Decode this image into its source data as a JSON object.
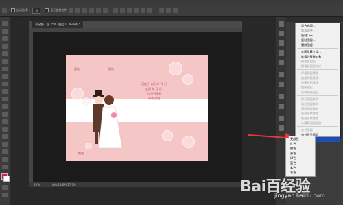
{
  "options_bar": {
    "auto_select_label": "自动选择:",
    "layer_dropdown": "组",
    "show_transform_label": "显示变换控件"
  },
  "document": {
    "tab_title": "未标题-1 @ 75% (图层 1, RGB/8) *",
    "zoom": "25%",
    "doc_info": "文档:13.6M/17.7M"
  },
  "artwork": {
    "title_left": "喜帖",
    "title_right": "喜帖",
    "text_lines": [
      "谨定于 公历 年 月 日",
      "农历 年 月 日",
      "为 举行婚礼",
      "恭请 光临"
    ],
    "footer_text": "敬邀"
  },
  "context_menu": {
    "items": [
      {
        "label": "混合选项...",
        "state": "normal"
      },
      {
        "label": "编辑调整...",
        "state": "disabled"
      },
      {
        "label": "复制CSS",
        "state": "normal"
      },
      {
        "label": "复制图层...",
        "state": "normal"
      },
      {
        "label": "删除图层",
        "state": "normal"
      },
      {
        "label": "从图层建立组...",
        "state": "normal"
      },
      {
        "label": "转换为智能对象",
        "state": "normal"
      },
      {
        "label": "栅格化图层",
        "state": "disabled"
      },
      {
        "label": "栅格化图层样式",
        "state": "disabled"
      },
      {
        "label": "停用图层蒙版",
        "state": "disabled"
      },
      {
        "label": "启用矢量蒙版",
        "state": "disabled"
      },
      {
        "label": "创建剪贴蒙版",
        "state": "disabled"
      },
      {
        "label": "链接图层",
        "state": "disabled"
      },
      {
        "label": "选择链接图层",
        "state": "disabled"
      },
      {
        "label": "拷贝图层样式",
        "state": "disabled"
      },
      {
        "label": "粘贴图层样式",
        "state": "disabled"
      },
      {
        "label": "清除图层样式",
        "state": "disabled"
      },
      {
        "label": "复制形状属性",
        "state": "disabled"
      },
      {
        "label": "粘贴形状属性",
        "state": "disabled"
      },
      {
        "label": "从隔离图层释放",
        "state": "disabled"
      },
      {
        "label": "合并图层",
        "state": "disabled"
      },
      {
        "label": "合并可见图层",
        "state": "normal"
      },
      {
        "label": "拼合图像",
        "state": "highlight"
      }
    ]
  },
  "color_submenu": {
    "items": [
      "无颜色",
      "红色",
      "橙色",
      "黄色",
      "绿色",
      "蓝色",
      "紫色",
      "灰色"
    ]
  },
  "watermark": {
    "brand": "Bai百经验",
    "url": "jingyan.baidu.com"
  },
  "colors": {
    "card_pink": "#f4c6c6",
    "highlight_blue": "#1c4fb4",
    "arrow_red": "#e8383b",
    "guide_cyan": "#1fbcbc"
  }
}
